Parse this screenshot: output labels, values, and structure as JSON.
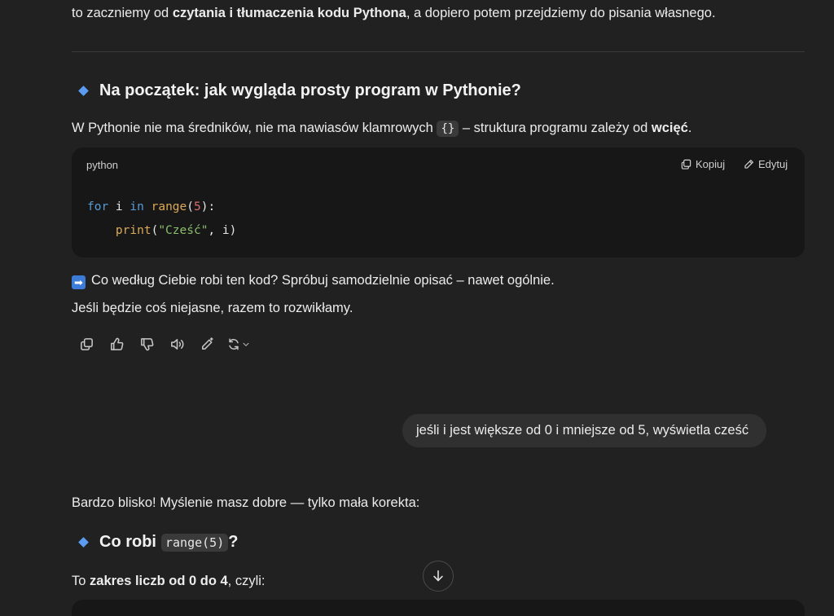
{
  "intro": {
    "text_before": "to zaczniemy od ",
    "bold": "czytania i tłumaczenia kodu Pythona",
    "text_after": ", a dopiero potem przejdziemy do pisania własnego."
  },
  "section1": {
    "heading": "Na początek: jak wygląda prosty program w Pythonie?",
    "para_before": "W Pythonie nie ma średników, nie ma nawiasów klamrowych ",
    "para_code": "{}",
    "para_middle": " – struktura programu zależy od ",
    "para_bold": "wcięć",
    "para_end": "."
  },
  "codeblock": {
    "language": "python",
    "copy_label": "Kopiuj",
    "edit_label": "Edytuj",
    "line1": {
      "kw1": "for",
      "t1": " i ",
      "kw2": "in",
      "t2": " ",
      "fn": "range",
      "p1": "(",
      "num": "5",
      "p2": "):"
    },
    "line2": {
      "indent": "    ",
      "fn": "print",
      "p1": "(",
      "str": "\"Cześć\"",
      "rest": ", i)"
    }
  },
  "question": {
    "line1": "Co według Ciebie robi ten kod? Spróbuj samodzielnie opisać – nawet ogólnie.",
    "line2": "Jeśli będzie coś niejasne, razem to rozwikłamy."
  },
  "toolbar": {
    "icons": [
      "copy-icon",
      "thumbs-up-icon",
      "thumbs-down-icon",
      "read-aloud-icon",
      "edit-icon",
      "regenerate-icon"
    ]
  },
  "user_message": "jeśli i jest większe od 0 i mniejsze od 5, wyświetla cześć",
  "reply": {
    "intro": "Bardzo blisko! Myślenie masz dobre — tylko mała korekta:",
    "heading_before": "Co robi ",
    "heading_code": "range(5)",
    "heading_after": "?",
    "para_before": "To ",
    "para_bold": "zakres liczb od 0 do 4",
    "para_after": ", czyli:"
  },
  "colors": {
    "background": "#212121",
    "code_background": "#171717",
    "bubble": "#303030",
    "accent_diamond": "#5b9bf0"
  }
}
